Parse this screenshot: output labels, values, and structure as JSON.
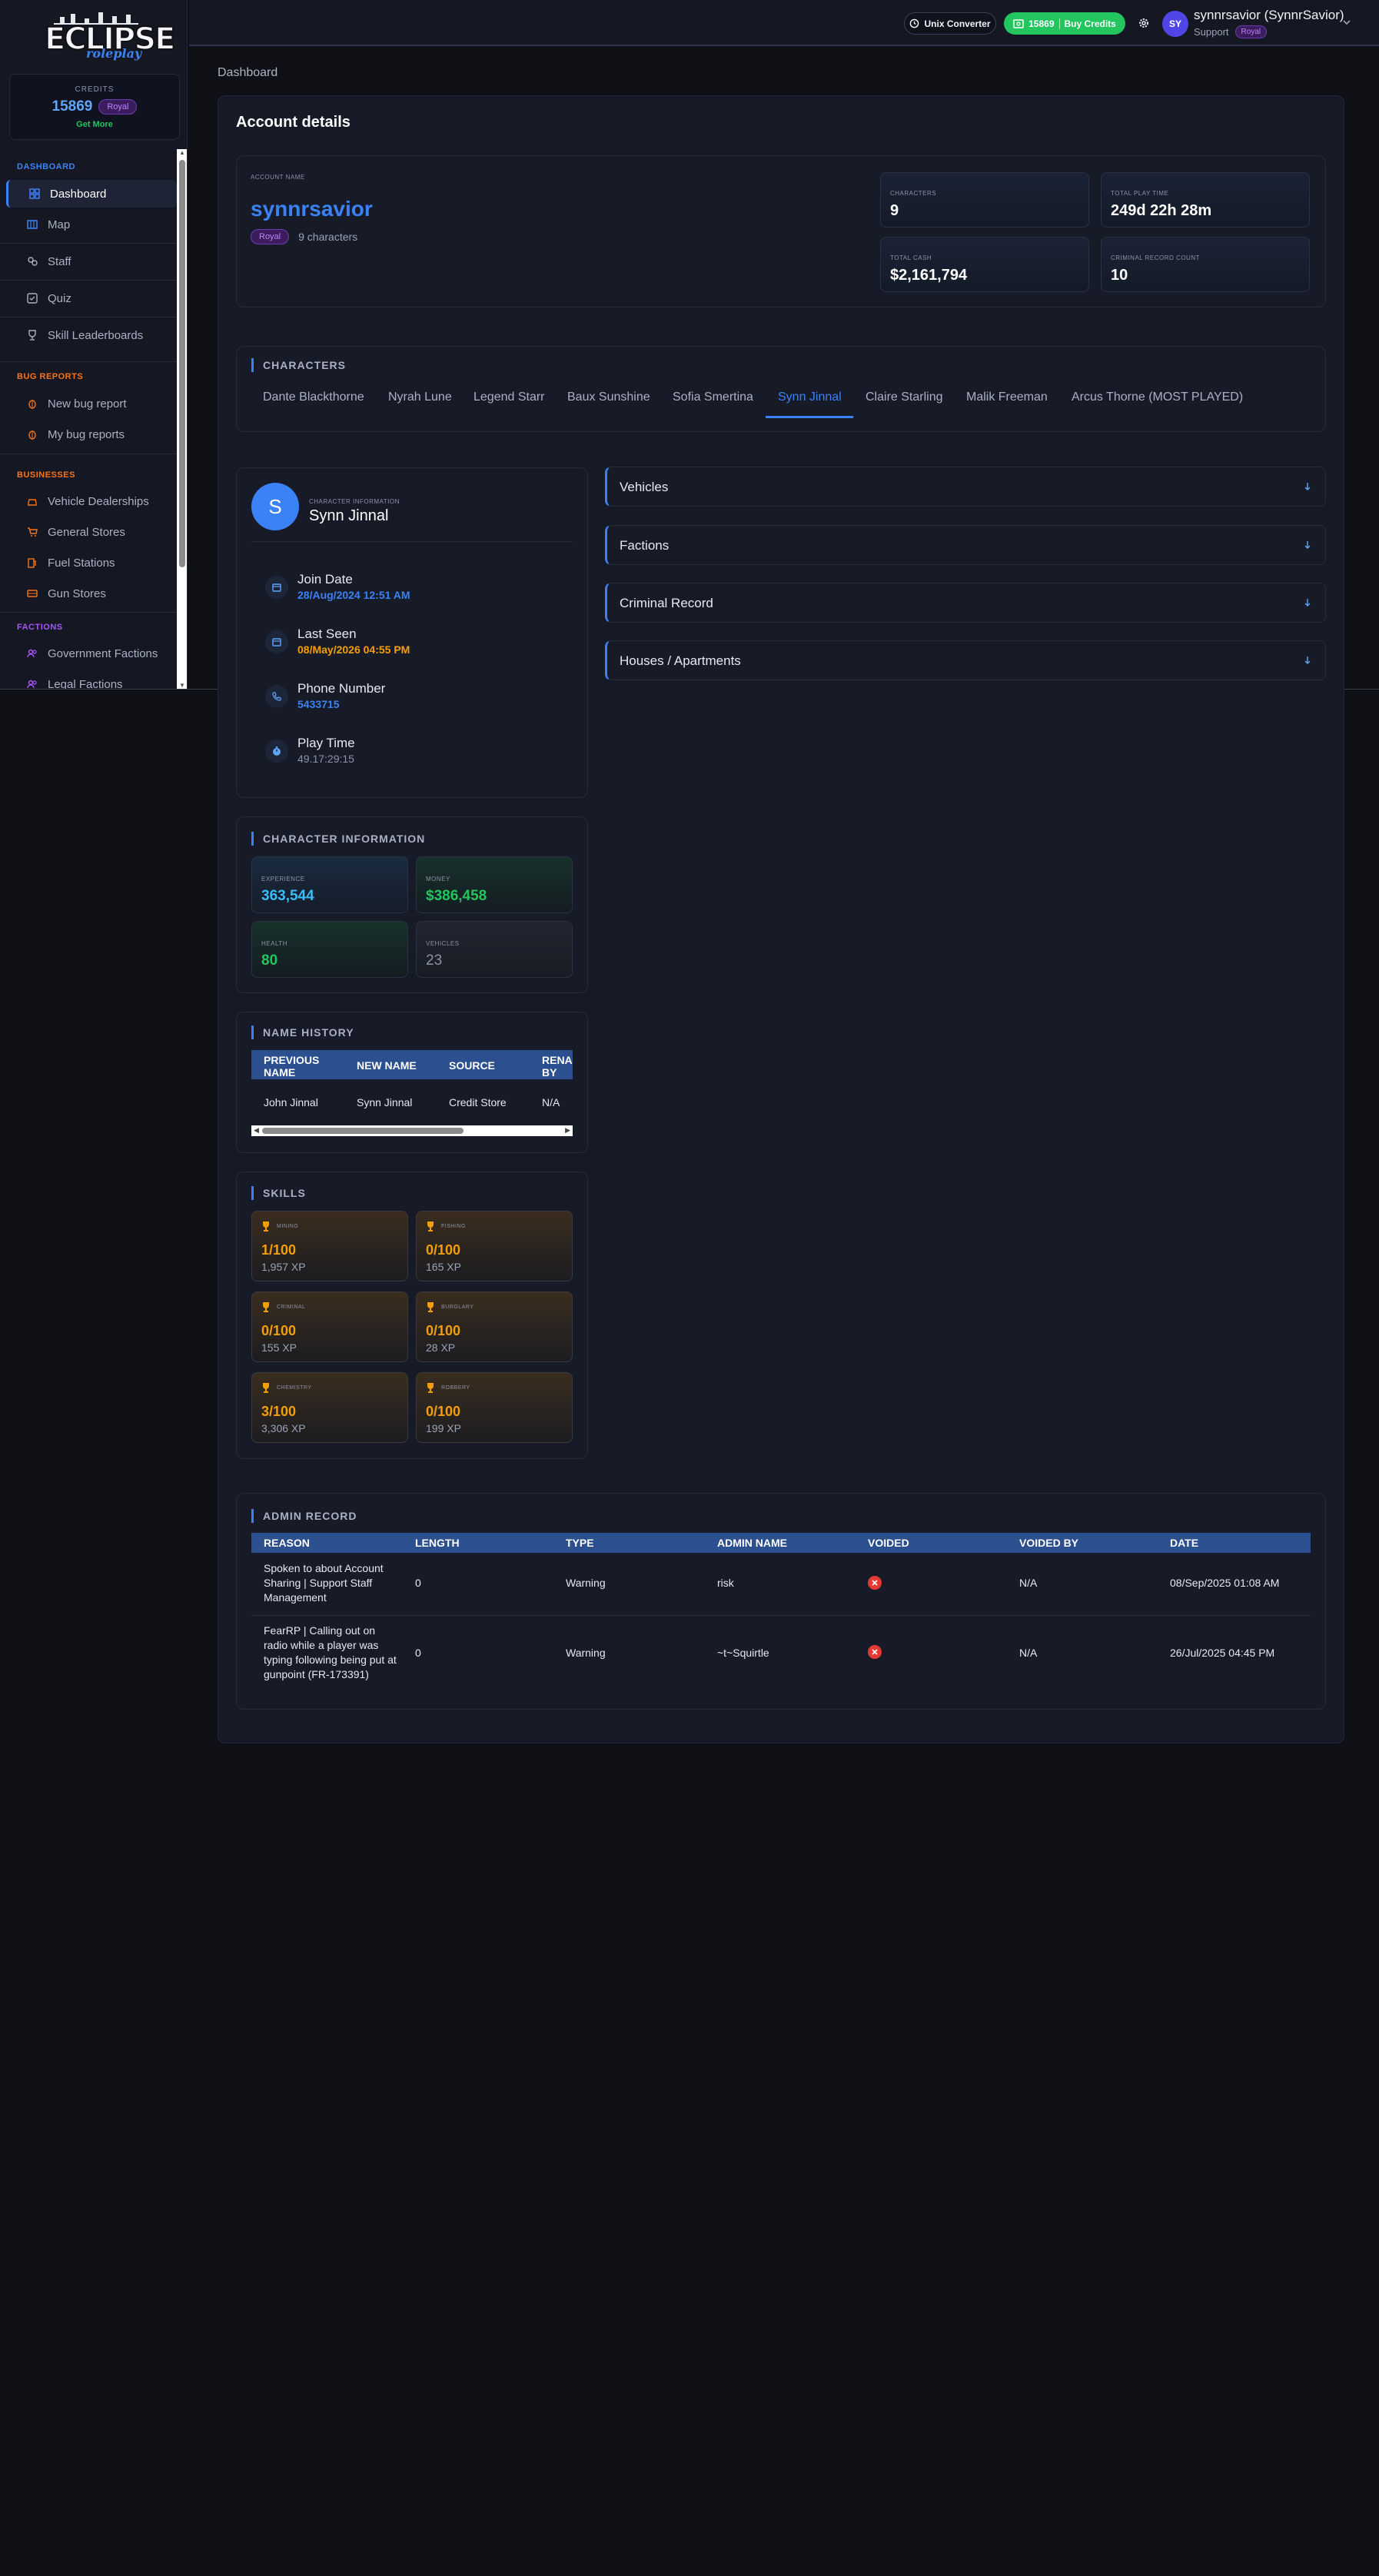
{
  "sidebar": {
    "logo": {
      "main": "ECLIPSE",
      "script": "roleplay"
    },
    "credits": {
      "label": "CREDITS",
      "amount": "15869",
      "tier": "Royal",
      "cta": "Get More"
    },
    "sections": [
      {
        "title": "DASHBOARD",
        "color": "#3b82f6"
      },
      {
        "title": "BUG REPORTS",
        "color": "#f97316"
      },
      {
        "title": "BUSINESSES",
        "color": "#f97316"
      },
      {
        "title": "FACTIONS",
        "color": "#a855f7"
      }
    ],
    "items": [
      {
        "label": "Dashboard",
        "icon": "dashboard-icon",
        "active": true
      },
      {
        "label": "Map",
        "icon": "map-icon"
      },
      {
        "label": "Staff",
        "icon": "staff-icon"
      },
      {
        "label": "Quiz",
        "icon": "quiz-icon"
      },
      {
        "label": "Skill Leaderboards",
        "icon": "trophy-icon"
      },
      {
        "label": "New bug report",
        "icon": "bug-icon"
      },
      {
        "label": "My bug reports",
        "icon": "bug-icon"
      },
      {
        "label": "Vehicle Dealerships",
        "icon": "car-icon"
      },
      {
        "label": "General Stores",
        "icon": "cart-icon"
      },
      {
        "label": "Fuel Stations",
        "icon": "fuel-icon"
      },
      {
        "label": "Gun Stores",
        "icon": "gun-icon"
      },
      {
        "label": "Government Factions",
        "icon": "users-icon"
      },
      {
        "label": "Legal Factions",
        "icon": "users-icon"
      }
    ]
  },
  "topbar": {
    "unix_label": "Unix Converter",
    "buy_amount": "15869",
    "buy_label": "Buy Credits",
    "avatar_initials": "SY",
    "user_name": "synnrsavior (SynnrSavior)",
    "user_role": "Support",
    "user_tier": "Royal"
  },
  "breadcrumb": "Dashboard",
  "panel_title": "Account details",
  "account": {
    "name_label": "ACCOUNT NAME",
    "name": "synnrsavior",
    "tier": "Royal",
    "characters_text": "9 characters",
    "stats": [
      {
        "label": "CHARACTERS",
        "value": "9"
      },
      {
        "label": "TOTAL PLAY TIME",
        "value": "249d 22h 28m"
      },
      {
        "label": "TOTAL CASH",
        "value": "$2,161,794"
      },
      {
        "label": "CRIMINAL RECORD COUNT",
        "value": "10"
      }
    ]
  },
  "characters": {
    "title": "CHARACTERS",
    "tabs": [
      "Dante Blackthorne",
      "Nyrah Lune",
      "Legend Starr",
      "Baux Sunshine",
      "Sofia Smertina",
      "Synn Jinnal",
      "Claire Starling",
      "Malik Freeman",
      "Arcus Thorne (MOST PLAYED)"
    ],
    "active_index": 5
  },
  "character": {
    "initial": "S",
    "info_label": "CHARACTER INFORMATION",
    "name": "Synn Jinnal",
    "rows": [
      {
        "label": "Join Date",
        "value": "28/Aug/2024 12:51 AM",
        "color": "#3b82f6",
        "icon": "calendar-icon"
      },
      {
        "label": "Last Seen",
        "value": "08/May/2026 04:55 PM",
        "color": "#f59e0b",
        "icon": "calendar-icon"
      },
      {
        "label": "Phone Number",
        "value": "5433715",
        "color": "#3b82f6",
        "icon": "phone-icon"
      },
      {
        "label": "Play Time",
        "value": "49.17:29:15",
        "color": "#8b93a6",
        "icon": "stopwatch-icon"
      }
    ]
  },
  "accordions": [
    "Vehicles",
    "Factions",
    "Criminal Record",
    "Houses / Apartments"
  ],
  "char_info": {
    "title": "CHARACTER INFORMATION",
    "tiles": [
      {
        "label": "EXPERIENCE",
        "value": "363,544",
        "color": "#38bdf8"
      },
      {
        "label": "MONEY",
        "value": "$386,458",
        "color": "#22c55e"
      },
      {
        "label": "HEALTH",
        "value": "80",
        "color": "#22c55e"
      },
      {
        "label": "VEHICLES",
        "value": "23",
        "color": "#8b93a6"
      }
    ]
  },
  "name_history": {
    "title": "NAME HISTORY",
    "headers": [
      "PREVIOUS NAME",
      "NEW NAME",
      "SOURCE",
      "RENA BY"
    ],
    "rows": [
      [
        "John Jinnal",
        "Synn Jinnal",
        "Credit Store",
        "N/A"
      ]
    ]
  },
  "skills": {
    "title": "SKILLS",
    "items": [
      {
        "label": "MINING",
        "level": "1/100",
        "xp": "1,957 XP"
      },
      {
        "label": "FISHING",
        "level": "0/100",
        "xp": "165 XP"
      },
      {
        "label": "CRIMINAL",
        "level": "0/100",
        "xp": "155 XP"
      },
      {
        "label": "BURGLARY",
        "level": "0/100",
        "xp": "28 XP"
      },
      {
        "label": "CHEMISTRY",
        "level": "3/100",
        "xp": "3,306 XP"
      },
      {
        "label": "ROBBERY",
        "level": "0/100",
        "xp": "199 XP"
      }
    ]
  },
  "admin_record": {
    "title": "ADMIN RECORD",
    "headers": [
      "REASON",
      "LENGTH",
      "TYPE",
      "ADMIN NAME",
      "VOIDED",
      "VOIDED BY",
      "DATE"
    ],
    "rows": [
      {
        "reason": "Spoken to about Account Sharing | Support Staff Management",
        "length": "0",
        "type": "Warning",
        "admin": "risk",
        "voided": false,
        "voided_by": "N/A",
        "date": "08/Sep/2025 01:08 AM"
      },
      {
        "reason": "FearRP | Calling out on radio while a player was typing following being put at gunpoint (FR-173391)",
        "length": "0",
        "type": "Warning",
        "admin": "~t~Squirtle",
        "voided": false,
        "voided_by": "N/A",
        "date": "26/Jul/2025 04:45 PM"
      }
    ]
  }
}
